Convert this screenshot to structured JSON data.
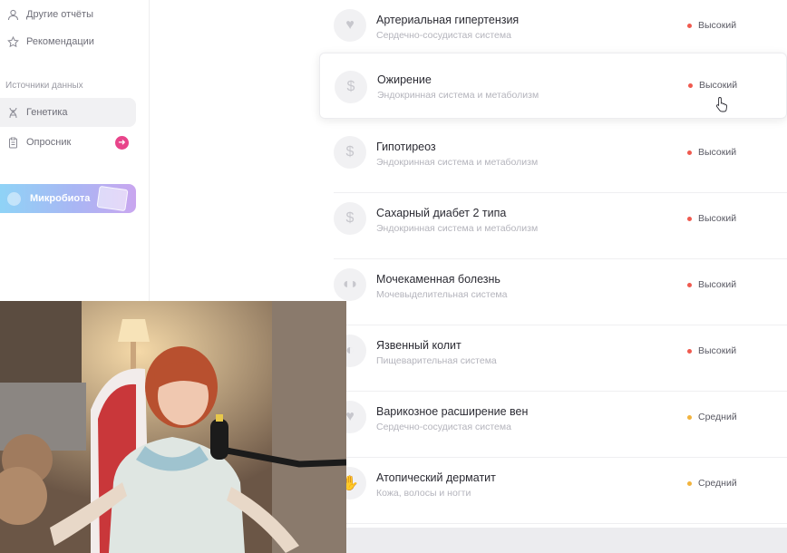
{
  "sidebar": {
    "top_items": [
      {
        "label": "Другие отчёты",
        "icon": "user-icon"
      },
      {
        "label": "Рекомендации",
        "icon": "star-icon"
      }
    ],
    "section_label": "Источники данных",
    "source_items": [
      {
        "label": "Генетика",
        "icon": "dna-icon",
        "active": true
      },
      {
        "label": "Опросник",
        "icon": "clipboard-icon",
        "badge_icon": "arrow-right-icon"
      }
    ],
    "microbiota": {
      "label": "Микробиота"
    }
  },
  "diseases": [
    {
      "title": "Артериальная гипертензия",
      "system": "Сердечно-сосудистая система",
      "risk": "Высокий",
      "risk_level": "high",
      "icon": "heart-icon"
    },
    {
      "title": "Ожирение",
      "system": "Эндокринная система и метаболизм",
      "risk": "Высокий",
      "risk_level": "high",
      "icon": "metabolism-icon",
      "hovered": true
    },
    {
      "title": "Гипотиреоз",
      "system": "Эндокринная система и метаболизм",
      "risk": "Высокий",
      "risk_level": "high",
      "icon": "metabolism-icon"
    },
    {
      "title": "Сахарный диабет 2 типа",
      "system": "Эндокринная система и метаболизм",
      "risk": "Высокий",
      "risk_level": "high",
      "icon": "metabolism-icon"
    },
    {
      "title": "Мочекаменная болезнь",
      "system": "Мочевыделительная система",
      "risk": "Высокий",
      "risk_level": "high",
      "icon": "kidney-icon"
    },
    {
      "title": "Язвенный колит",
      "system": "Пищеварительная система",
      "risk": "Высокий",
      "risk_level": "high",
      "icon": "stomach-icon"
    },
    {
      "title": "Варикозное расширение вен",
      "system": "Сердечно-сосудистая система",
      "risk": "Средний",
      "risk_level": "medium",
      "icon": "heart-icon"
    },
    {
      "title": "Атопический дерматит",
      "system": "Кожа, волосы и ногти",
      "risk": "Средний",
      "risk_level": "medium",
      "icon": "skin-icon"
    }
  ],
  "colors": {
    "risk_high": "#ef5a4f",
    "risk_medium": "#f2b33d",
    "accent_pink": "#e8448a"
  }
}
